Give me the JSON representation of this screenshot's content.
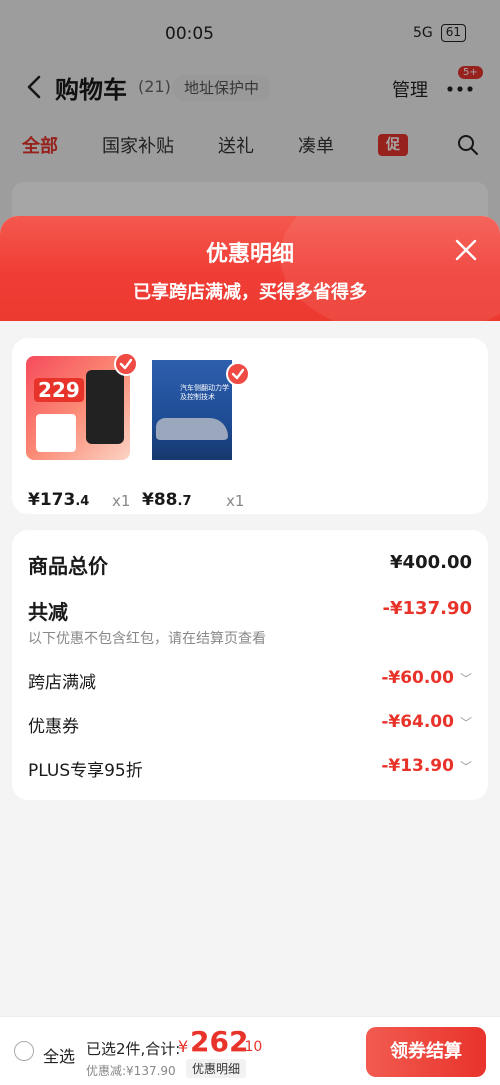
{
  "status_bar": {
    "time": "00:05",
    "network": "5G",
    "battery": "61"
  },
  "header": {
    "title": "购物车",
    "count": "(21)",
    "address_chip": "地址保护中",
    "manage": "管理",
    "badge": "5+"
  },
  "tabs": [
    {
      "label": "全部",
      "active": true
    },
    {
      "label": "国家补贴"
    },
    {
      "label": "送礼"
    },
    {
      "label": "凑单"
    },
    {
      "label": "促"
    }
  ],
  "sheet": {
    "title": "优惠明细",
    "subtitle": "已享跨店满减，买得多省得多"
  },
  "products": [
    {
      "thumb_text": "229",
      "price_int": "¥173",
      "price_dec": ".4",
      "qty": "x1"
    },
    {
      "thumb_text": "汽车侧翻动力学及控制技术",
      "price_int": "¥88",
      "price_dec": ".7",
      "qty": "x1"
    }
  ],
  "summary": {
    "total_label": "商品总价",
    "total_value": "¥400.00",
    "reduction_label": "共减",
    "reduction_value": "-¥137.90",
    "note": "以下优惠不包含红包，请在结算页查看",
    "items": [
      {
        "label": "跨店满减",
        "value": "-¥60.00"
      },
      {
        "label": "优惠券",
        "value": "-¥64.00"
      },
      {
        "label": "PLUS专享95折",
        "value": "-¥13.90"
      }
    ]
  },
  "bottom_bar": {
    "select_all": "全选",
    "selected_info": "已选2件,合计:",
    "total_symbol": "¥",
    "total_int": "262",
    "total_dec": ".10",
    "discount_line": "优惠减:¥137.90",
    "detail_chip": "优惠明细",
    "checkout": "领券结算"
  },
  "colors": {
    "accent": "#e8332b",
    "sheet_header": "#f03d36"
  }
}
